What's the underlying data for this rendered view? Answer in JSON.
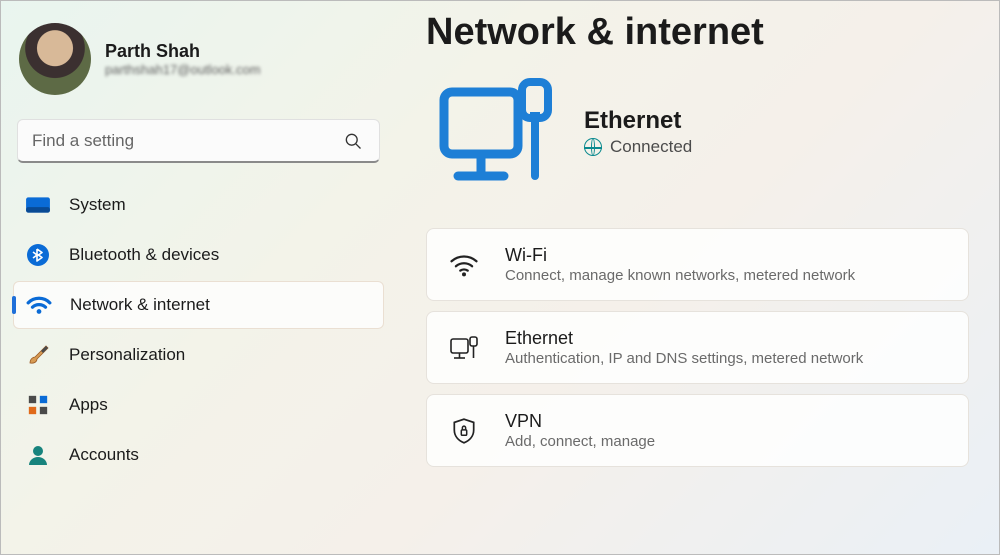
{
  "user": {
    "name": "Parth Shah",
    "email": "parthshah17@outlook.com"
  },
  "search": {
    "placeholder": "Find a setting"
  },
  "sidebar": {
    "items": [
      {
        "label": "System",
        "icon": "system-icon"
      },
      {
        "label": "Bluetooth & devices",
        "icon": "bluetooth-icon"
      },
      {
        "label": "Network & internet",
        "icon": "wifi-icon"
      },
      {
        "label": "Personalization",
        "icon": "brush-icon"
      },
      {
        "label": "Apps",
        "icon": "apps-icon"
      },
      {
        "label": "Accounts",
        "icon": "accounts-icon"
      }
    ],
    "selected_index": 2
  },
  "page": {
    "title": "Network & internet",
    "status": {
      "name": "Ethernet",
      "state": "Connected"
    }
  },
  "cards": [
    {
      "title": "Wi-Fi",
      "subtitle": "Connect, manage known networks, metered network",
      "icon": "wifi-card-icon"
    },
    {
      "title": "Ethernet",
      "subtitle": "Authentication, IP and DNS settings, metered network",
      "icon": "ethernet-card-icon"
    },
    {
      "title": "VPN",
      "subtitle": "Add, connect, manage",
      "icon": "vpn-card-icon"
    }
  ],
  "annotation": {
    "type": "red-arrow",
    "points_to": "connected-status"
  }
}
